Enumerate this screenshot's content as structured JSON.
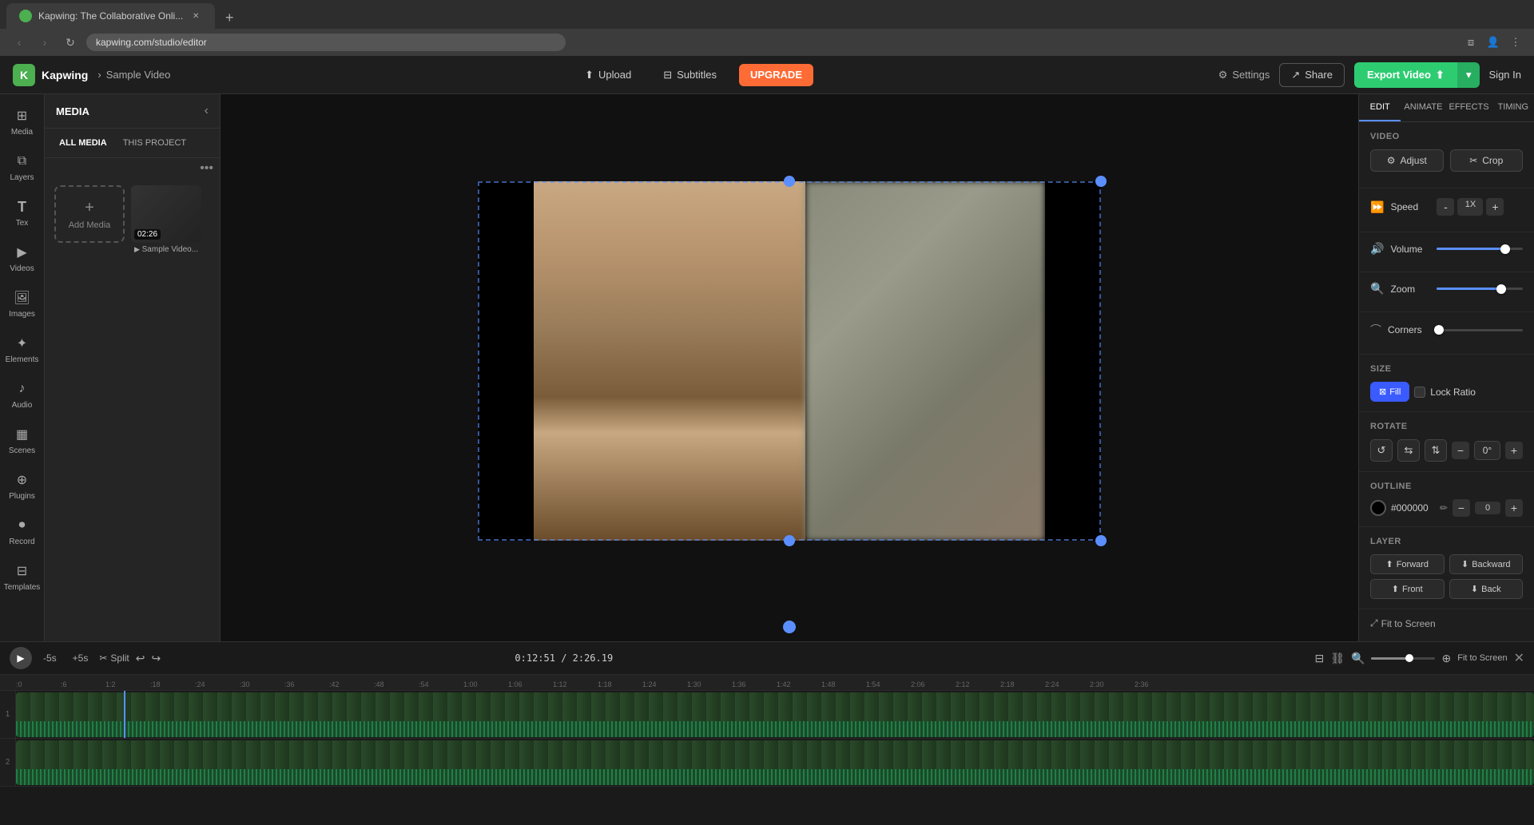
{
  "browser": {
    "tab_title": "Kapwing: The Collaborative Onli...",
    "url": "kapwing.com/studio/editor",
    "new_tab_label": "+",
    "nav": {
      "back": "‹",
      "forward": "›",
      "refresh": "↻",
      "bookmark": "☆"
    }
  },
  "header": {
    "logo_letter": "K",
    "app_name": "Kapwing",
    "breadcrumb_sep": "›",
    "project_name": "Sample Video",
    "upload_label": "Upload",
    "subtitles_label": "Subtitles",
    "upgrade_label": "UPGRADE",
    "settings_label": "Settings",
    "share_label": "Share",
    "export_label": "Export Video",
    "signin_label": "Sign In"
  },
  "left_sidebar": {
    "items": [
      {
        "id": "media",
        "icon": "⊞",
        "label": "Media"
      },
      {
        "id": "layers",
        "icon": "⧉",
        "label": "Layers"
      },
      {
        "id": "text",
        "icon": "T",
        "label": "Tex"
      },
      {
        "id": "videos",
        "icon": "▶",
        "label": "Videos"
      },
      {
        "id": "images",
        "icon": "🖼",
        "label": "Images"
      },
      {
        "id": "elements",
        "icon": "◈",
        "label": "Elements"
      },
      {
        "id": "audio",
        "icon": "♪",
        "label": "Audio"
      },
      {
        "id": "scenes",
        "icon": "▦",
        "label": "Scenes"
      },
      {
        "id": "plugins",
        "icon": "⊕",
        "label": "Plugins"
      },
      {
        "id": "record",
        "icon": "⏺",
        "label": "Record"
      },
      {
        "id": "templates",
        "icon": "⊟",
        "label": "Templates"
      }
    ]
  },
  "media_panel": {
    "title": "MEDIA",
    "tabs": [
      {
        "id": "all",
        "label": "ALL MEDIA"
      },
      {
        "id": "project",
        "label": "THIS PROJECT"
      }
    ],
    "add_media_label": "Add Media",
    "add_media_icon": "+",
    "media_items": [
      {
        "time": "02:26",
        "name": "Sample Video..."
      }
    ]
  },
  "right_panel": {
    "tabs": [
      "EDIT",
      "ANIMATE",
      "EFFECTS",
      "TIMING"
    ],
    "active_tab": "EDIT",
    "video_section": {
      "title": "VIDEO",
      "adjust_label": "Adjust",
      "crop_label": "Crop"
    },
    "speed": {
      "label": "Speed",
      "minus": "-",
      "value": "1X",
      "plus": "+"
    },
    "volume": {
      "label": "Volume",
      "fill_pct": 80
    },
    "zoom": {
      "label": "Zoom",
      "fill_pct": 75
    },
    "corners": {
      "label": "Corners",
      "fill_pct": 5
    },
    "size": {
      "title": "SIZE",
      "fill_label": "Fill",
      "lock_ratio_label": "Lock Ratio"
    },
    "rotate": {
      "title": "ROTATE",
      "ccw_icon": "↺",
      "flip_h_icon": "⇆",
      "flip_v_icon": "⇅",
      "minus": "-",
      "value": "0°",
      "plus": "+"
    },
    "outline": {
      "title": "OUTLINE",
      "color": "#000000",
      "color_label": "#000000",
      "minus": "-",
      "value": "0",
      "plus": "+"
    },
    "layer": {
      "title": "LAYER",
      "forward_label": "Forward",
      "backward_label": "Backward",
      "front_label": "Front",
      "back_label": "Back"
    }
  },
  "timeline": {
    "skip_back": "-5s",
    "skip_forward": "+5s",
    "split_label": "Split",
    "current_time": "0:12:51",
    "total_time": "2:26.19",
    "time_display": "0:12:51 / 2:26.19",
    "fit_screen_label": "Fit to Screen",
    "ruler_marks": [
      ":0",
      ":6",
      "1:2",
      ":18",
      ":24",
      ":30",
      ":36",
      ":42",
      ":48",
      ":54",
      "1:00",
      "1:06",
      "1:12",
      "1:18",
      "1:24",
      "1:30",
      "1:36",
      "1:42",
      "1:48",
      "1:54",
      "2:06",
      "2:12",
      "2:18",
      "2:24",
      "2:30",
      "2:36"
    ],
    "tracks": [
      {
        "id": "track1",
        "label": "1"
      },
      {
        "id": "track2",
        "label": "2"
      }
    ]
  }
}
